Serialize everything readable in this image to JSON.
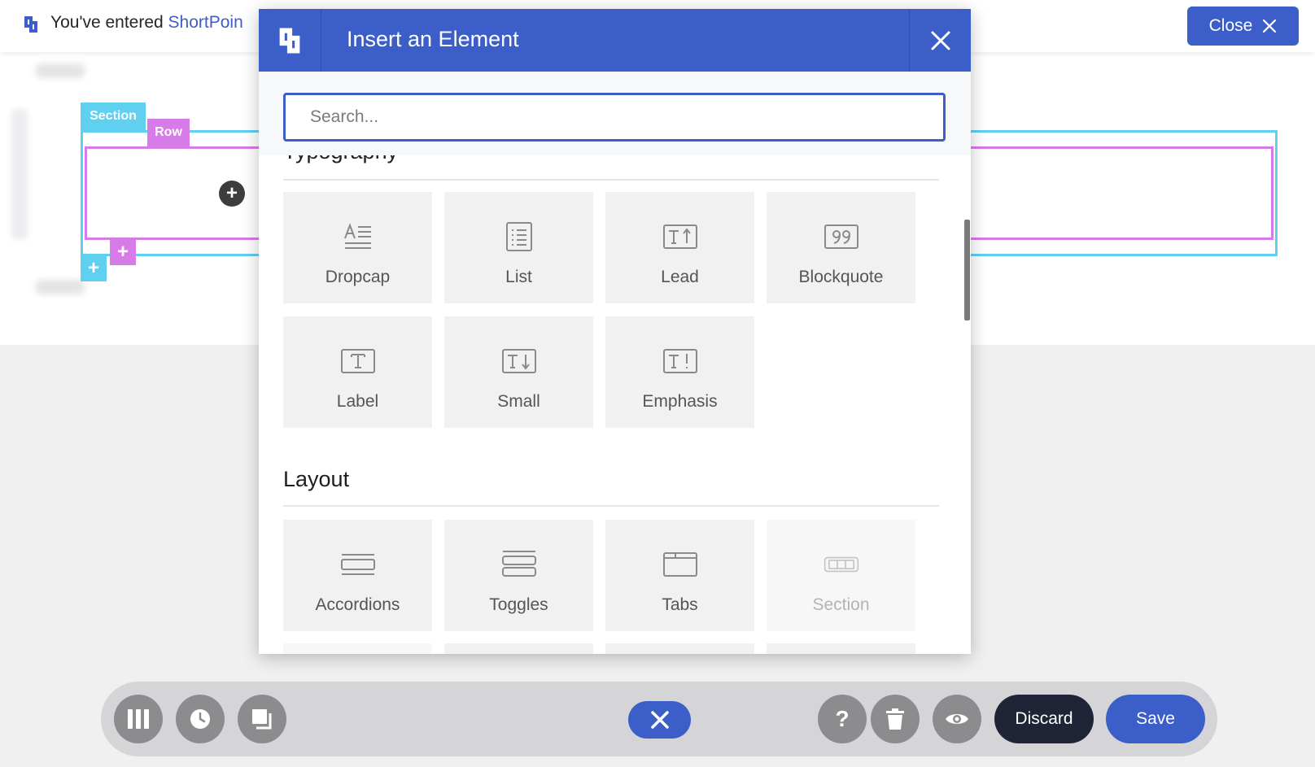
{
  "topbar": {
    "prefix": "You've entered",
    "brand": "ShortPoin",
    "close_label": "Close"
  },
  "editor": {
    "section_tag": "Section",
    "row_tag": "Row",
    "add_symbol": "+"
  },
  "modal": {
    "title": "Insert an Element",
    "search_placeholder": "Search...",
    "categories": [
      {
        "title": "Typography",
        "items": [
          {
            "label": "Dropcap",
            "icon": "dropcap-icon"
          },
          {
            "label": "List",
            "icon": "list-icon"
          },
          {
            "label": "Lead",
            "icon": "lead-icon"
          },
          {
            "label": "Blockquote",
            "icon": "blockquote-icon"
          },
          {
            "label": "Label",
            "icon": "label-icon"
          },
          {
            "label": "Small",
            "icon": "small-icon"
          },
          {
            "label": "Emphasis",
            "icon": "emphasis-icon"
          }
        ]
      },
      {
        "title": "Layout",
        "items": [
          {
            "label": "Accordions",
            "icon": "accordions-icon"
          },
          {
            "label": "Toggles",
            "icon": "toggles-icon"
          },
          {
            "label": "Tabs",
            "icon": "tabs-icon"
          },
          {
            "label": "Section",
            "icon": "section-icon",
            "disabled": true
          }
        ]
      }
    ]
  },
  "toolbar": {
    "discard_label": "Discard",
    "save_label": "Save"
  },
  "colors": {
    "accent": "#3b5ec9",
    "section_outline": "#5fd0f0",
    "row_outline": "#d67be8",
    "discard_bg": "#1f2437"
  }
}
